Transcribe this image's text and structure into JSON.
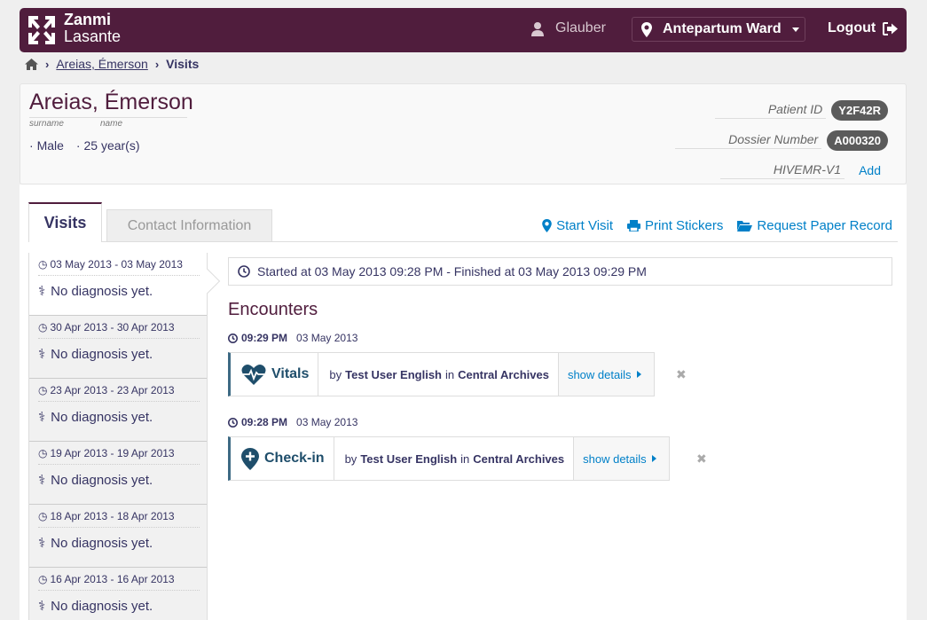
{
  "header": {
    "logo_line1": "Zanmi",
    "logo_line2": "Lasante",
    "user": "Glauber",
    "location": "Antepartum Ward",
    "logout": "Logout"
  },
  "breadcrumb": {
    "patient": "Areias, Émerson",
    "current": "Visits"
  },
  "patient": {
    "name": "Areias, Émerson",
    "surname_label": "surname",
    "name_label": "name",
    "gender": "Male",
    "age": "25 year(s)",
    "ids": [
      {
        "label": "Patient ID",
        "value": "Y2F42R"
      },
      {
        "label": "Dossier Number",
        "value": "A000320"
      }
    ],
    "hivemr_label": "HIVEMR-V1",
    "add_label": "Add"
  },
  "tabs": {
    "visits": "Visits",
    "contact": "Contact Information"
  },
  "actions": {
    "start_visit": "Start Visit",
    "print_stickers": "Print Stickers",
    "request_record": "Request Paper Record"
  },
  "visits": [
    {
      "date": "03 May 2013 - 03 May 2013",
      "diagnosis": "No diagnosis yet."
    },
    {
      "date": "30 Apr 2013 - 30 Apr 2013",
      "diagnosis": "No diagnosis yet."
    },
    {
      "date": "23 Apr 2013 - 23 Apr 2013",
      "diagnosis": "No diagnosis yet."
    },
    {
      "date": "19 Apr 2013 - 19 Apr 2013",
      "diagnosis": "No diagnosis yet."
    },
    {
      "date": "18 Apr 2013 - 18 Apr 2013",
      "diagnosis": "No diagnosis yet."
    },
    {
      "date": "16 Apr 2013 - 16 Apr 2013",
      "diagnosis": "No diagnosis yet."
    }
  ],
  "visit_detail": {
    "status": "Started at 03 May 2013 09:28 PM - Finished at 03 May 2013 09:29 PM",
    "encounters_title": "Encounters",
    "encounters": [
      {
        "time": "09:29 PM",
        "date": "03 May 2013",
        "type": "Vitals",
        "by": "by",
        "user": "Test User English",
        "in": "in",
        "location": "Central Archives",
        "details": "show details"
      },
      {
        "time": "09:28 PM",
        "date": "03 May 2013",
        "type": "Check-in",
        "by": "by",
        "user": "Test User English",
        "in": "in",
        "location": "Central Archives",
        "details": "show details"
      }
    ]
  },
  "colors": {
    "brand": "#501d3d",
    "link": "#0080c8",
    "badge": "#5b5b5b"
  }
}
